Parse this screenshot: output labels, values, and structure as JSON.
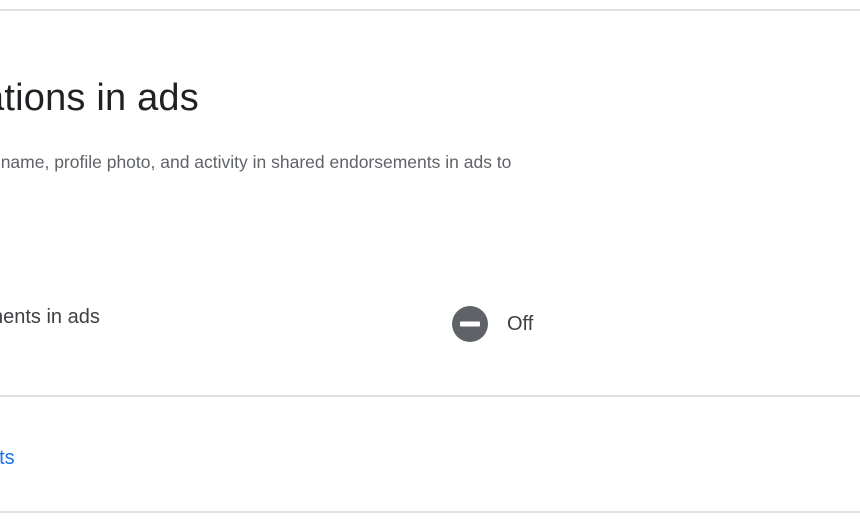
{
  "section": {
    "title": "ations in ads",
    "description": "r name, profile photo, and activity in shared endorsements in ads to"
  },
  "setting": {
    "label": "nents in ads",
    "status_icon": "minus-circle-icon",
    "status_text": "Off",
    "status_icon_color": "#5f6368"
  },
  "link": {
    "label": "nts",
    "color": "#1a73e8"
  }
}
